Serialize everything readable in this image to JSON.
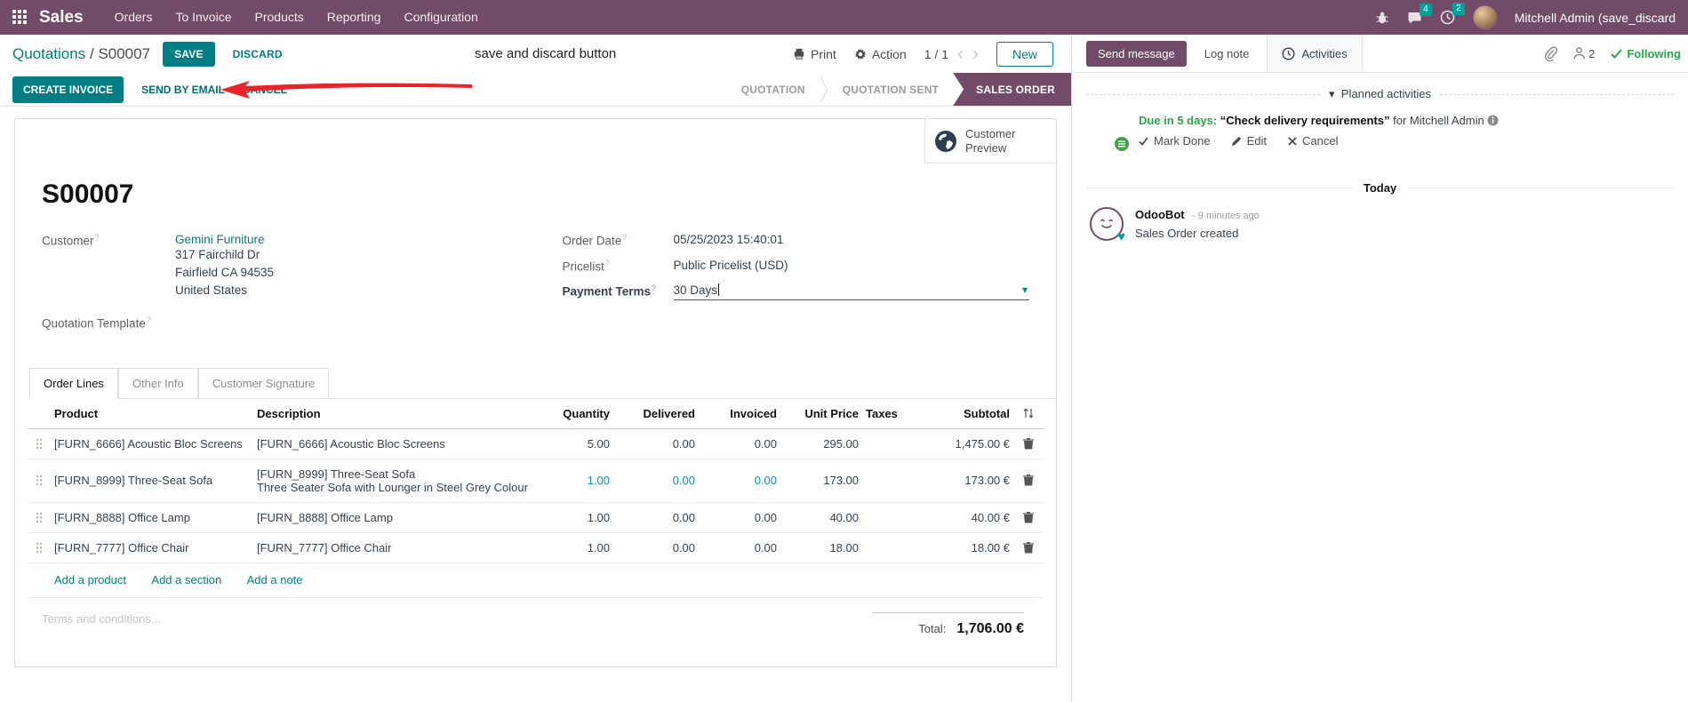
{
  "colors": {
    "brand_purple": "#714b67",
    "primary_teal": "#017e84",
    "badge_teal": "#00a09d",
    "success_green": "#28a745",
    "edited_blue": "#0f8dbc",
    "annotation_red": "#e8252a"
  },
  "icons": {
    "caret_down": "▾",
    "collapse_caret": "▾",
    "chevron_left": "‹",
    "chevron_right": "›",
    "heart": "♥",
    "stage_separator": "›"
  },
  "nav": {
    "app_name": "Sales",
    "menu_items": [
      "Orders",
      "To Invoice",
      "Products",
      "Reporting",
      "Configuration"
    ],
    "messages_badge": "4",
    "activities_badge": "2",
    "user_name": "Mitchell Admin (save_discard"
  },
  "control_panel": {
    "breadcrumb_parent": "Quotations",
    "breadcrumb_separator": "/",
    "breadcrumb_current": "S00007",
    "save_label": "SAVE",
    "discard_label": "DISCARD",
    "annotation_text": "save and discard button",
    "print_label": "Print",
    "action_label": "Action",
    "pager_value": "1 / 1",
    "new_label": "New"
  },
  "status_row": {
    "buttons": [
      "CREATE INVOICE",
      "SEND BY EMAIL",
      "CANCEL"
    ],
    "stages": [
      "QUOTATION",
      "QUOTATION SENT",
      "SALES ORDER"
    ],
    "active_stage": "SALES ORDER"
  },
  "sheet": {
    "customer_preview_label": "Customer Preview",
    "title": "S00007",
    "help_marker": "?",
    "customer": {
      "label": "Customer",
      "name": "Gemini Furniture",
      "address_lines": [
        "317 Fairchild Dr",
        "Fairfield CA 94535",
        "United States"
      ]
    },
    "quotation_template_label": "Quotation Template",
    "order_date": {
      "label": "Order Date",
      "value": "05/25/2023 15:40:01"
    },
    "pricelist": {
      "label": "Pricelist",
      "value": "Public Pricelist (USD)"
    },
    "payment_terms": {
      "label": "Payment Terms",
      "value": "30 Days"
    },
    "tabs": [
      "Order Lines",
      "Other Info",
      "Customer Signature"
    ],
    "table": {
      "headers": [
        "Product",
        "Description",
        "Quantity",
        "Delivered",
        "Invoiced",
        "Unit Price",
        "Taxes",
        "Subtotal"
      ],
      "rows": [
        {
          "product": "[FURN_6666] Acoustic Bloc Screens",
          "description": "[FURN_6666] Acoustic Bloc Screens",
          "description2": "",
          "quantity": "5.00",
          "delivered": "0.00",
          "invoiced": "0.00",
          "unit_price": "295.00",
          "taxes": "",
          "subtotal": "1,475.00 €"
        },
        {
          "product": "[FURN_8999] Three-Seat Sofa",
          "description": "[FURN_8999] Three-Seat Sofa",
          "description2": "Three Seater Sofa with Lounger in Steel Grey Colour",
          "quantity": "1.00",
          "delivered": "0.00",
          "invoiced": "0.00",
          "unit_price": "173.00",
          "taxes": "",
          "subtotal": "173.00 €"
        },
        {
          "product": "[FURN_8888] Office Lamp",
          "description": "[FURN_8888] Office Lamp",
          "description2": "",
          "quantity": "1.00",
          "delivered": "0.00",
          "invoiced": "0.00",
          "unit_price": "40.00",
          "taxes": "",
          "subtotal": "40.00 €"
        },
        {
          "product": "[FURN_7777] Office Chair",
          "description": "[FURN_7777] Office Chair",
          "description2": "",
          "quantity": "1.00",
          "delivered": "0.00",
          "invoiced": "0.00",
          "unit_price": "18.00",
          "taxes": "",
          "subtotal": "18.00 €"
        }
      ],
      "footer_links": [
        "Add a product",
        "Add a section",
        "Add a note"
      ]
    },
    "terms_placeholder": "Terms and conditions...",
    "total_label": "Total:",
    "total_value": "1,706.00 €"
  },
  "chatter": {
    "send_message_label": "Send message",
    "log_note_label": "Log note",
    "activities_label": "Activities",
    "followers_count": "2",
    "following_label": "Following",
    "planned_activities_title": "Planned activities",
    "activity": {
      "due": "Due in 5 days:",
      "summary": "“Check delivery requirements”",
      "assignee": "for Mitchell Admin",
      "actions": [
        "Mark Done",
        "Edit",
        "Cancel"
      ]
    },
    "today_label": "Today",
    "message": {
      "author": "OdooBot",
      "time": "- 9 minutes ago",
      "body": "Sales Order created"
    }
  }
}
